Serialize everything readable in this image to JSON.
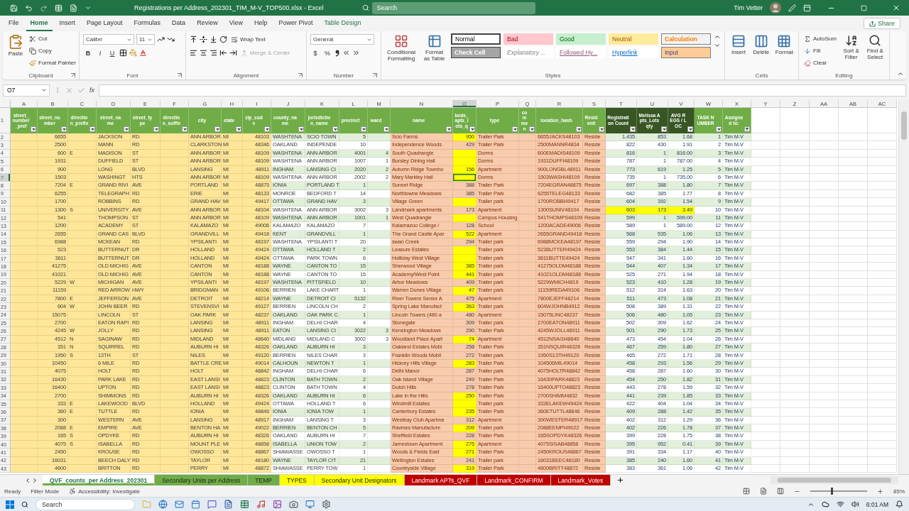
{
  "window": {
    "title": "Registrations per Address_202301_TIM_M-V_TOP500.xlsx  -  Excel",
    "search_placeholder": "Search",
    "user": "Tim Vetter"
  },
  "ribbon_tabs": [
    {
      "label": "File",
      "selected": false,
      "kind": "standard"
    },
    {
      "label": "Home",
      "selected": true,
      "kind": "standard"
    },
    {
      "label": "Insert",
      "selected": false,
      "kind": "standard"
    },
    {
      "label": "Page Layout",
      "selected": false,
      "kind": "standard"
    },
    {
      "label": "Formulas",
      "selected": false,
      "kind": "standard"
    },
    {
      "label": "Data",
      "selected": false,
      "kind": "standard"
    },
    {
      "label": "Review",
      "selected": false,
      "kind": "standard"
    },
    {
      "label": "View",
      "selected": false,
      "kind": "standard"
    },
    {
      "label": "Help",
      "selected": false,
      "kind": "standard"
    },
    {
      "label": "Power Pivot",
      "selected": false,
      "kind": "standard"
    },
    {
      "label": "Table Design",
      "selected": false,
      "kind": "contextual"
    }
  ],
  "share": "Share",
  "ribbon": [
    {
      "kind": "clipboard",
      "label": "Clipboard",
      "paste": "Paste",
      "cut": "Cut",
      "copy": "Copy",
      "format_painter": "Format Painter"
    },
    {
      "kind": "font",
      "label": "Font",
      "font": "Calibri",
      "size": "11",
      "bold": "B",
      "italic": "I",
      "underline": "U"
    },
    {
      "kind": "alignment",
      "label": "Alignment",
      "wrap": "Wrap Text",
      "merge": "Merge & Center",
      "merge_disabled": true
    },
    {
      "kind": "number",
      "label": "Number",
      "format": "General",
      "currency": "$",
      "percent": "%"
    },
    {
      "kind": "styles",
      "label": "Styles",
      "conditional": "Conditional Formatting",
      "format_table": "Format as Table",
      "cells": [
        {
          "label": "Normal",
          "kind": "normal",
          "selected": true
        },
        {
          "label": "Bad",
          "kind": "bad",
          "selected": false
        },
        {
          "label": "Good",
          "kind": "good",
          "selected": false
        },
        {
          "label": "Neutral",
          "kind": "neutral",
          "selected": false
        },
        {
          "label": "Calculation",
          "kind": "calculation",
          "selected": false
        },
        {
          "label": "Check Cell",
          "kind": "check",
          "selected": false
        },
        {
          "label": "Explanatory ...",
          "kind": "explanatory",
          "selected": false
        },
        {
          "label": "Followed Hy...",
          "kind": "followed",
          "selected": false
        },
        {
          "label": "Hyperlink",
          "kind": "hyperlink",
          "selected": false
        },
        {
          "label": "Input",
          "kind": "input",
          "selected": false
        }
      ]
    },
    {
      "kind": "cells",
      "label": "Cells",
      "buttons": [
        "Insert",
        "Delete",
        "Format"
      ]
    },
    {
      "kind": "editing",
      "label": "Editing",
      "autosum": "AutoSum",
      "fill": "Fill",
      "clear": "Clear",
      "sort": "Sort & Filter",
      "find": "Find & Select"
    }
  ],
  "formula_bar": {
    "name_box": "O7",
    "fx": "fx"
  },
  "table": {
    "header_row_number": "1",
    "columns": [
      {
        "letter": "A",
        "header": "street_number_pref",
        "kind": "address",
        "selected": false,
        "filtered": false
      },
      {
        "letter": "B",
        "header": "street_number",
        "kind": "address",
        "selected": false,
        "filtered": false
      },
      {
        "letter": "C",
        "header": "direction_prefix",
        "kind": "address",
        "selected": false,
        "filtered": false
      },
      {
        "letter": "D",
        "header": "street_name",
        "kind": "address",
        "selected": false,
        "filtered": false
      },
      {
        "letter": "E",
        "header": "street_type",
        "kind": "address",
        "selected": false,
        "filtered": false
      },
      {
        "letter": "F",
        "header": "direction_suffix",
        "kind": "address",
        "selected": false,
        "filtered": false
      },
      {
        "letter": "G",
        "header": "city",
        "kind": "address",
        "selected": false,
        "filtered": false
      },
      {
        "letter": "H",
        "header": "state",
        "kind": "address",
        "selected": false,
        "filtered": false
      },
      {
        "letter": "I",
        "header": "zip_code",
        "kind": "address",
        "selected": false,
        "filtered": false
      },
      {
        "letter": "J",
        "header": "county_name",
        "kind": "county",
        "selected": false,
        "filtered": false
      },
      {
        "letter": "K",
        "header": "jurisdiction_name",
        "kind": "county",
        "selected": false,
        "filtered": false
      },
      {
        "letter": "L",
        "header": "precinct",
        "kind": "county",
        "selected": false,
        "filtered": false
      },
      {
        "letter": "M",
        "header": "ward",
        "kind": "county",
        "selected": false,
        "filtered": false
      },
      {
        "letter": "N",
        "header": "name",
        "kind": "site",
        "selected": false,
        "filtered": false
      },
      {
        "letter": "O",
        "header": "beds_apts_lots_q",
        "kind": "beds",
        "selected": true,
        "filtered": false
      },
      {
        "letter": "P",
        "header": "type",
        "kind": "site",
        "selected": false,
        "filtered": false
      },
      {
        "letter": "Q",
        "header": "commen",
        "kind": "site",
        "selected": false,
        "filtered": false
      },
      {
        "letter": "R",
        "header": "location_hash",
        "kind": "site",
        "selected": false,
        "filtered": false
      },
      {
        "letter": "S",
        "header": "Residenti",
        "kind": "site",
        "selected": false,
        "filtered": false
      },
      {
        "letter": "T",
        "header": "Registration Count",
        "kind": "counts",
        "selected": false,
        "filtered": false
      },
      {
        "letter": "U",
        "header": "Melissa Apts_Lots qty",
        "kind": "counts",
        "selected": false,
        "filtered": false
      },
      {
        "letter": "V",
        "header": "AVG REGS / LOC",
        "kind": "counts",
        "selected": false,
        "filtered": false
      },
      {
        "letter": "W",
        "header": "TASK NUMBER",
        "kind": "task",
        "selected": false,
        "filtered": false
      },
      {
        "letter": "X",
        "header": "Assigned to:",
        "kind": "task",
        "selected": false,
        "filtered": true
      }
    ],
    "extra_columns": [
      "Y",
      "Z",
      "AA",
      "AB",
      "AC"
    ],
    "rows": [
      {
        "number": "2",
        "selected": false,
        "beds_highlighted": true,
        "counts_highlighted": false,
        "cells": [
          null,
          "6655",
          null,
          "JACKSON",
          "RD",
          null,
          "ANN ARBOR",
          "MI",
          "48103",
          "WASHTENA",
          "SCIO TOWN",
          "5",
          null,
          "Scio Farms",
          "950",
          "Trailer Park",
          null,
          "6655JACKS48103",
          "Reside",
          "1,435",
          "853",
          "1.68",
          "1",
          "Tim M-V"
        ]
      },
      {
        "number": "3",
        "selected": false,
        "beds_highlighted": false,
        "counts_highlighted": false,
        "cells": [
          null,
          "2500",
          null,
          "MANN",
          "RD",
          null,
          "CLARKSTON",
          "MI",
          "48346",
          "OAKLAND",
          "INDEPENDE",
          "10",
          null,
          "Independence Woods",
          "429",
          "Trailer Park",
          null,
          "2500MANNR4834",
          "Reside",
          "822",
          "430",
          "1.91",
          "2",
          "Tim M-V"
        ]
      },
      {
        "number": "4",
        "selected": false,
        "beds_highlighted": true,
        "counts_highlighted": false,
        "cells": [
          null,
          "600",
          "E",
          "MADISON",
          "ST",
          null,
          "ANN ARBOR",
          "MI",
          "48109",
          "WASHTENA",
          "ANN ARBOR",
          "4001",
          "4",
          "South Quadrangle",
          null,
          "Dorms",
          null,
          "600EMADIS48109",
          "Reside",
          "816",
          "1",
          "816.00",
          "3",
          "Tim M-V"
        ]
      },
      {
        "number": "5",
        "selected": false,
        "beds_highlighted": true,
        "counts_highlighted": false,
        "cells": [
          null,
          "1931",
          null,
          "DUFFIELD",
          "ST",
          null,
          "ANN ARBOR",
          "MI",
          "48109",
          "WASHTENA",
          "ANN ARBOR",
          "1007",
          "1",
          "Bursley Dining Hall",
          null,
          "Dorms",
          null,
          "1931DUFFI48109",
          "Reside",
          "787",
          "1",
          "787.00",
          "4",
          "Tim M-V"
        ]
      },
      {
        "number": "6",
        "selected": false,
        "beds_highlighted": true,
        "counts_highlighted": false,
        "cells": [
          null,
          "900",
          null,
          "LONG",
          "BLVD",
          null,
          "LANSING",
          "MI",
          "48911",
          "INGHAM",
          "LANSING CI",
          "2020",
          "2",
          "Autumn Ridge Townho",
          "156",
          "Apartment",
          null,
          "900LONGBL48911",
          "Reside",
          "773",
          "619",
          "1.25",
          "5",
          "Tim M-V"
        ]
      },
      {
        "number": "7",
        "selected": true,
        "beds_highlighted": true,
        "counts_highlighted": false,
        "cells": [
          null,
          "1503",
          null,
          "WASHINGT",
          "HTS",
          null,
          "ANN ARBOR",
          "MI",
          "48109",
          "WASHTENA",
          "ANN ARBOR",
          "2002",
          "2",
          "Mary Markley Hall",
          null,
          "Dorms",
          null,
          "1503WASHI48109",
          "Reside",
          "735",
          "1",
          "735.00",
          "6",
          "Tim M-V"
        ]
      },
      {
        "number": "8",
        "selected": false,
        "beds_highlighted": false,
        "counts_highlighted": false,
        "cells": [
          null,
          "7204",
          "E",
          "GRAND RIVI",
          "AVE",
          null,
          "PORTLAND",
          "MI",
          "48875",
          "IONIA",
          "PORTLAND T",
          "1",
          null,
          "Sunset Ridge",
          "388",
          "Trailer Park",
          null,
          "7204EGRAN48875",
          "Reside",
          "697",
          "388",
          "1.80",
          "7",
          "Tim M-V"
        ]
      },
      {
        "number": "9",
        "selected": false,
        "beds_highlighted": false,
        "counts_highlighted": false,
        "cells": [
          null,
          "6255",
          null,
          "TELEGRAPH",
          "RD",
          null,
          "ERIE",
          "MI",
          "48133",
          "MONROE",
          "BEDFORD T",
          "14",
          null,
          "Northtowne Meadows",
          "385",
          "Trailer Park",
          null,
          "6255TELEG48133",
          "Reside",
          "682",
          "385",
          "1.77",
          "8",
          "Tim M-V"
        ]
      },
      {
        "number": "10",
        "selected": false,
        "beds_highlighted": true,
        "counts_highlighted": false,
        "cells": [
          null,
          "1700",
          null,
          "ROBBINS",
          "RD",
          null,
          "GRAND HAV",
          "MI",
          "49417",
          "OTTAWA",
          "GRAND HAV",
          "3",
          null,
          "Village Green",
          null,
          "Trailer park",
          null,
          "1700ROBBI49417",
          "Reside",
          "604",
          "392",
          "1.54",
          "9",
          "Tim M-V"
        ]
      },
      {
        "number": "11",
        "selected": false,
        "beds_highlighted": false,
        "counts_highlighted": true,
        "cells": [
          null,
          "1300",
          "S",
          "UNIVERSITY",
          "AVE",
          null,
          "ANN ARBOR",
          "MI",
          "48104",
          "WASHTENA",
          "ANN ARBOR",
          "3002",
          "3",
          "Landmark apartments",
          "173",
          "Apartment",
          null,
          "1300SUNIV48104",
          "Reside",
          "603",
          "173",
          "3.49",
          "10",
          "Tim M-V"
        ]
      },
      {
        "number": "12",
        "selected": false,
        "beds_highlighted": true,
        "counts_highlighted": false,
        "cells": [
          null,
          "541",
          null,
          "THOMPSON",
          "ST",
          null,
          "ANN ARBOR",
          "MI",
          "48109",
          "WASHTENA",
          "ANN ARBOR",
          "1001",
          "1",
          "West Quadrangle",
          null,
          "Campus Housing",
          null,
          "541THOMPS48109",
          "Reside",
          "599",
          "1",
          "599.00",
          "11",
          "Tim M-V"
        ]
      },
      {
        "number": "13",
        "selected": false,
        "beds_highlighted": false,
        "counts_highlighted": false,
        "cells": [
          null,
          "1200",
          null,
          "ACADEMY",
          "ST",
          null,
          "KALAMAZO",
          "MI",
          "49006",
          "KALAMAZO",
          "KALAMAZO",
          "7",
          null,
          "Kalamazoo College /",
          "128",
          "School",
          null,
          "1200ACADE49006",
          "Reside",
          "589",
          "1",
          "589.00",
          "12",
          "Tim M-V"
        ]
      },
      {
        "number": "14",
        "selected": false,
        "beds_highlighted": true,
        "counts_highlighted": false,
        "cells": [
          null,
          "2655",
          null,
          "GRAND CAS",
          "BLVD",
          null,
          "GRANDVILL",
          "MI",
          "49418",
          "KENT",
          "GRANDVILL",
          "1",
          null,
          "The Grand Castle Apar",
          "522",
          "Apartment",
          null,
          "2655GRAND49418",
          "Reside",
          "568",
          "535",
          "1.06",
          "13",
          "Tim M-V"
        ]
      },
      {
        "number": "15",
        "selected": false,
        "beds_highlighted": false,
        "counts_highlighted": false,
        "cells": [
          null,
          "6988",
          null,
          "MCKEAN",
          "RD",
          null,
          "YPSILANTI",
          "MI",
          "48197",
          "WASHTENA",
          "YPSILANTI T",
          "20",
          null,
          "swan Creek",
          "294",
          "Trailer park",
          null,
          "6988MCKEA48197",
          "Reside",
          "559",
          "294",
          "1.90",
          "14",
          "Tim M-V"
        ]
      },
      {
        "number": "16",
        "selected": false,
        "beds_highlighted": true,
        "counts_highlighted": false,
        "cells": [
          null,
          "523",
          null,
          "BUTTERNUT",
          "DR",
          null,
          "HOLLAND",
          "MI",
          "49424",
          "OTTAWA",
          "HOLLAND T",
          "2",
          null,
          "Leasure Estates",
          null,
          "Trailer park",
          null,
          "523BUTTER49424",
          "Reside",
          "553",
          "384",
          "1.44",
          "15",
          "Tim M-V"
        ]
      },
      {
        "number": "17",
        "selected": false,
        "beds_highlighted": true,
        "counts_highlighted": false,
        "cells": [
          null,
          "3611",
          null,
          "BUTTERNUT",
          "DR",
          null,
          "HOLLAND",
          "MI",
          "49424",
          "OTTAWA",
          "PARK TOWN",
          "6",
          null,
          "Holliday West Village",
          null,
          "Trailer park",
          null,
          "3611BUTTE49424",
          "Reside",
          "547",
          "341",
          "1.60",
          "16",
          "Tim M-V"
        ]
      },
      {
        "number": "18",
        "selected": false,
        "beds_highlighted": true,
        "counts_highlighted": false,
        "cells": [
          null,
          "41275",
          null,
          "OLD MICHIG",
          "AVE",
          null,
          "CANTON",
          "MI",
          "48188",
          "WAYNE",
          "CANTON TO",
          "15",
          null,
          "Sherwood Village",
          "385",
          "Trailer park",
          null,
          "41275OLDM48188",
          "Reside",
          "544",
          "407",
          "1.34",
          "17",
          "Tim M-V"
        ]
      },
      {
        "number": "19",
        "selected": false,
        "beds_highlighted": true,
        "counts_highlighted": false,
        "cells": [
          null,
          "41021",
          null,
          "OLD MICHIG",
          "AVE",
          null,
          "CANTON",
          "MI",
          "48188",
          "WAYNE",
          "CANTON TO",
          "15",
          null,
          "Academy/West Point",
          "441",
          "Trailer park",
          null,
          "41021OLDM48188",
          "Reside",
          "525",
          "271",
          "1.94",
          "18",
          "Tim M-V"
        ]
      },
      {
        "number": "20",
        "selected": false,
        "beds_highlighted": false,
        "counts_highlighted": false,
        "cells": [
          null,
          "5229",
          "W",
          "MICHIGAN",
          "AVE",
          null,
          "YPSILANTI",
          "MI",
          "48197",
          "WASHTENA",
          "PITTSFIELD",
          "10",
          null,
          "Arbor Meadows",
          "409",
          "Trailer park",
          null,
          "5229WMICH4819",
          "Reside",
          "523",
          "410",
          "1.28",
          "19",
          "Tim M-V"
        ]
      },
      {
        "number": "21",
        "selected": false,
        "beds_highlighted": true,
        "counts_highlighted": false,
        "cells": [
          null,
          "11159",
          null,
          "RED ARROW",
          "HWY",
          null,
          "BRIDGMAN",
          "MI",
          "49106",
          "BERRIEN",
          "LAKE CHART",
          "1",
          null,
          "Warren Dunes Village",
          "47",
          "Trailer park",
          null,
          "11159REDA49106",
          "Reside",
          "512",
          "314",
          "1.63",
          "20",
          "Tim M-V"
        ]
      },
      {
        "number": "22",
        "selected": false,
        "beds_highlighted": false,
        "counts_highlighted": false,
        "cells": [
          null,
          "7800",
          "E",
          "JEFFERSON",
          "AVE",
          null,
          "DETROIT",
          "MI",
          "48214",
          "WAYNE",
          "DETROIT CI",
          "5132",
          null,
          "River Towers Senior A",
          "475",
          "Apartment",
          null,
          "7800EJEFF48214",
          "Reside",
          "511",
          "473",
          "1.08",
          "21",
          "Tim M-V"
        ]
      },
      {
        "number": "23",
        "selected": false,
        "beds_highlighted": true,
        "counts_highlighted": false,
        "cells": [
          null,
          "604",
          "W",
          "JOHN BEER",
          "RD",
          null,
          "STEVENSVI",
          "MI",
          "49127",
          "BERRIEN",
          "LINCOLN CH",
          "2",
          null,
          "Spring Lake Manufact",
          "363",
          "Trailer park",
          null,
          "604WJOHNB4912",
          "Reside",
          "508",
          "389",
          "1.31",
          "22",
          "Tim M-V"
        ]
      },
      {
        "number": "24",
        "selected": false,
        "beds_highlighted": false,
        "counts_highlighted": false,
        "cells": [
          null,
          "15075",
          null,
          "LINCOLN",
          "ST",
          null,
          "OAK PARK",
          "MI",
          "48237",
          "OAKLAND",
          "OAK PARK C",
          "1",
          null,
          "Lincoln Towers (480 a",
          "480",
          "Apartment",
          null,
          "15075LINC48237",
          "Reside",
          "506",
          "480",
          "1.05",
          "23",
          "Tim M-V"
        ]
      },
      {
        "number": "25",
        "selected": false,
        "beds_highlighted": false,
        "counts_highlighted": false,
        "cells": [
          null,
          "2700",
          null,
          "EATON RAPI",
          "RD",
          null,
          "LANSING",
          "MI",
          "48911",
          "INGHAM",
          "DELHI CHAR",
          "4",
          null,
          "Stonegate",
          "309",
          "Trailer park",
          null,
          "2700EATON48911",
          "Reside",
          "502",
          "309",
          "1.62",
          "24",
          "Tim M-V"
        ]
      },
      {
        "number": "26",
        "selected": false,
        "beds_highlighted": false,
        "counts_highlighted": false,
        "cells": [
          null,
          "4245",
          "W",
          "JOLLY",
          "RD",
          null,
          "LANSING",
          "MI",
          "48911",
          "EATON",
          "LANSING CI",
          "3022",
          "3",
          "Kensington Meadows",
          "290",
          "Trailer Park",
          null,
          "4245WJOLL48911",
          "Reside",
          "501",
          "290",
          "1.73",
          "25",
          "Tim M-V"
        ]
      },
      {
        "number": "27",
        "selected": false,
        "beds_highlighted": true,
        "counts_highlighted": false,
        "cells": [
          null,
          "4512",
          "N",
          "SAGINAW",
          "RD",
          null,
          "MIDLAND",
          "MI",
          "48640",
          "MIDLAND",
          "MIDLAND C",
          "3002",
          "3",
          "Woodland Place Apart",
          "74",
          "Apartment",
          null,
          "4512NSAGI48640",
          "Reside",
          "473",
          "454",
          "1.04",
          "26",
          "Tim M-V"
        ]
      },
      {
        "number": "28",
        "selected": false,
        "beds_highlighted": false,
        "counts_highlighted": false,
        "cells": [
          null,
          "351",
          "N",
          "SQUIRREL",
          "RD",
          null,
          "AUBURN HI",
          "MI",
          "48326",
          "OAKLAND",
          "AUBURN HI",
          "3",
          null,
          "Oakland Estates Mobi",
          "258",
          "Trailer Park",
          null,
          "351NSQUIR48326",
          "Reside",
          "467",
          "259",
          "1.80",
          "27",
          "Tim M-V"
        ]
      },
      {
        "number": "29",
        "selected": false,
        "beds_highlighted": false,
        "counts_highlighted": false,
        "cells": [
          null,
          "1950",
          "S",
          "13TH",
          "ST",
          null,
          "NILES",
          "MI",
          "49120",
          "BERRIEN",
          "NILES CHAR",
          "3",
          null,
          "Franklin Woods Mobil",
          "272",
          "Trailer park",
          null,
          "1950S13TH49120",
          "Reside",
          "465",
          "272",
          "1.71",
          "28",
          "Tim M-V"
        ]
      },
      {
        "number": "30",
        "selected": false,
        "beds_highlighted": true,
        "counts_highlighted": false,
        "cells": [
          null,
          "10450",
          null,
          "6 MILE",
          "RD",
          null,
          "BATTLE CRE",
          "MI",
          "49014",
          "CALHOUN",
          "NEWTON T",
          "1",
          null,
          "Hickory Hills Village",
          "283",
          "Trailer Park",
          null,
          "104506MIL49014",
          "Reside",
          "458",
          "293",
          "1.56",
          "29",
          "Tim M-V"
        ]
      },
      {
        "number": "31",
        "selected": false,
        "beds_highlighted": false,
        "counts_highlighted": false,
        "cells": [
          null,
          "4075",
          null,
          "HOLT",
          "RD",
          null,
          "HOLT",
          "MI",
          "48842",
          "INGHAM",
          "DELHI CHAR",
          "6",
          null,
          "Delhi Manor",
          "287",
          "Trailer park",
          null,
          "4075HOLTR48842",
          "Reside",
          "458",
          "287",
          "1.60",
          "30",
          "Tim M-V"
        ]
      },
      {
        "number": "32",
        "selected": false,
        "beds_highlighted": false,
        "counts_highlighted": false,
        "cells": [
          null,
          "16430",
          null,
          "PARK LAKE",
          "RD",
          null,
          "EAST LANSI",
          "MI",
          "48823",
          "CLINTON",
          "BATH TOWN",
          "2",
          null,
          "Oak Island Village",
          "249",
          "Trailer Park",
          null,
          "16430PARK48823",
          "Reside",
          "454",
          "250",
          "1.82",
          "31",
          "Tim M-V"
        ]
      },
      {
        "number": "33",
        "selected": false,
        "beds_highlighted": false,
        "counts_highlighted": false,
        "cells": [
          null,
          "16400",
          null,
          "UPTON",
          "RD",
          null,
          "EAST LANSI",
          "MI",
          "48823",
          "CLINTON",
          "BATH TOWN",
          "4",
          null,
          "Dutch Hills",
          "278",
          "Trailer Park",
          null,
          "16400UPTO48823",
          "Reside",
          "443",
          "278",
          "1.59",
          "32",
          "Tim M-V"
        ]
      },
      {
        "number": "34",
        "selected": false,
        "beds_highlighted": true,
        "counts_highlighted": false,
        "cells": [
          null,
          "2700",
          null,
          "SHIMMONS",
          "RD",
          null,
          "AUBURN HI",
          "MI",
          "48326",
          "OAKLAND",
          "AUBURN HI",
          "6",
          null,
          "Lake in the Hills",
          "250",
          "Trailer Park",
          null,
          "2700SHIMM4832",
          "Reside",
          "441",
          "239",
          "1.85",
          "33",
          "Tim M-V"
        ]
      },
      {
        "number": "35",
        "selected": false,
        "beds_highlighted": true,
        "counts_highlighted": false,
        "cells": [
          null,
          "333",
          "E",
          "LAKEWOOD",
          "BLVD",
          null,
          "HOLLAND",
          "MI",
          "49424",
          "OTTAWA",
          "HOLLAND T",
          "6",
          null,
          "Windmill Estates",
          null,
          "Trailer park",
          null,
          "333ELAKEW49424",
          "Reside",
          "422",
          "404",
          "1.04",
          "34",
          "Tim M-V"
        ]
      },
      {
        "number": "36",
        "selected": false,
        "beds_highlighted": true,
        "counts_highlighted": false,
        "cells": [
          null,
          "360",
          "E",
          "TUTTLE",
          "RD",
          null,
          "IONIA",
          "MI",
          "48846",
          "IONIA",
          "IONIA TOW",
          "1",
          null,
          "Canterbury Estates",
          "235",
          "Trailer Park",
          null,
          "360ETUTTL48846",
          "Reside",
          "409",
          "288",
          "1.42",
          "35",
          "Tim M-V"
        ]
      },
      {
        "number": "37",
        "selected": false,
        "beds_highlighted": false,
        "counts_highlighted": false,
        "cells": [
          null,
          "300",
          null,
          "WESTERN",
          "AVE",
          null,
          "LANSING",
          "MI",
          "48917",
          "INGHAM",
          "LANSING T",
          "3",
          null,
          "Westbay Club Apartme",
          "312",
          "Apartment",
          null,
          "300WESTER48917",
          "Reside",
          "402",
          "312",
          "1.29",
          "36",
          "Tim M-V"
        ]
      },
      {
        "number": "38",
        "selected": false,
        "beds_highlighted": true,
        "counts_highlighted": false,
        "cells": [
          null,
          "2088",
          "E",
          "EMPIRE",
          "AVE",
          null,
          "BENTON HA",
          "MI",
          "49022",
          "BERRIEN",
          "BENTON CH",
          "5",
          null,
          "Ravines Manufacture",
          "209",
          "Trailer park",
          null,
          "2088EEMPI49022",
          "Reside",
          "402",
          "226",
          "1.78",
          "37",
          "Tim M-V"
        ]
      },
      {
        "number": "39",
        "selected": false,
        "beds_highlighted": false,
        "counts_highlighted": false,
        "cells": [
          null,
          "165",
          "S",
          "OPDYKE",
          "RD",
          null,
          "AUBURN HI",
          "MI",
          "48326",
          "OAKLAND",
          "AUBURN HI",
          "7",
          null,
          "Sheffield Estates",
          "228",
          "Trailer Park",
          null,
          "165SOPDYK48326",
          "Reside",
          "399",
          "228",
          "1.75",
          "38",
          "Tim M-V"
        ]
      },
      {
        "number": "40",
        "selected": false,
        "beds_highlighted": true,
        "counts_highlighted": false,
        "cells": [
          null,
          "4075",
          "S",
          "ISABELLA",
          "RD",
          null,
          "MOUNT PLE",
          "MI",
          "48858",
          "ISABELLA",
          "UNION TOW",
          "2",
          null,
          "Jamestown Apartment",
          "275",
          "Apartment",
          null,
          "4075SISAB48858",
          "Reside",
          "395",
          "952",
          "0.41",
          "39",
          "Tim M-V"
        ]
      },
      {
        "number": "41",
        "selected": false,
        "beds_highlighted": true,
        "counts_highlighted": false,
        "cells": [
          null,
          "2450",
          null,
          "KROUSE",
          "RD",
          null,
          "OWOSSO",
          "MI",
          "48867",
          "SHIAWASSE",
          "OWOSSO T",
          "1",
          null,
          "Woods & Fields East",
          "271",
          "Trailer Park",
          null,
          "2450KROUS48867",
          "Reside",
          "391",
          "334",
          "1.17",
          "40",
          "Tim M-V"
        ]
      },
      {
        "number": "42",
        "selected": false,
        "beds_highlighted": false,
        "counts_highlighted": false,
        "cells": [
          null,
          "16031",
          null,
          "BEECH DALY",
          "RD",
          null,
          "TAYLOR",
          "MI",
          "48180",
          "WAYNE",
          "TAYLOR CIT",
          "21",
          null,
          "Wellington Estates",
          "241",
          "Trailer park",
          null,
          "16031BEEC48180",
          "Reside",
          "385",
          "240",
          "1.60",
          "41",
          "Tim M-V"
        ]
      },
      {
        "number": "43",
        "selected": false,
        "beds_highlighted": true,
        "counts_highlighted": false,
        "cells": [
          null,
          "4600",
          null,
          "BRITTON",
          "RD",
          null,
          "PERRY",
          "MI",
          "48872",
          "SHIAWASSE",
          "PERRY TOW",
          "1",
          null,
          "Countryside Village",
          "319",
          "Trailer Park",
          null,
          "4600BRITT48872",
          "Reside",
          "383",
          "361",
          "1.06",
          "42",
          "Tim M-V"
        ]
      }
    ]
  },
  "sheet_tabs": [
    {
      "label": "QVF_counts_per Address_202301",
      "selected": true,
      "color": "#70ad47"
    },
    {
      "label": "Secondary Units per Address",
      "selected": false,
      "color": "#70ad47"
    },
    {
      "label": "TEMP",
      "selected": false,
      "color": "#70ad47"
    },
    {
      "label": "TYPES",
      "selected": false,
      "color": "#ffff00"
    },
    {
      "label": "Secondary Unit Designators",
      "selected": false,
      "color": "#ffff00"
    },
    {
      "label": "Landmark APTs_QVF",
      "selected": false,
      "color": "#c00000"
    },
    {
      "label": "Landmark_CONFIRM",
      "selected": false,
      "color": "#c00000"
    },
    {
      "label": "Landmark_Votes",
      "selected": false,
      "color": "#c00000"
    }
  ],
  "status_bar": {
    "mode": "Ready",
    "filter": "Filter Mode",
    "accessibility": "Accessibility: Investigate",
    "zoom": {
      "level": 0.37,
      "reading": "85%"
    }
  },
  "taskbar": {
    "search_placeholder": "Search",
    "time": "6:01 AM"
  }
}
